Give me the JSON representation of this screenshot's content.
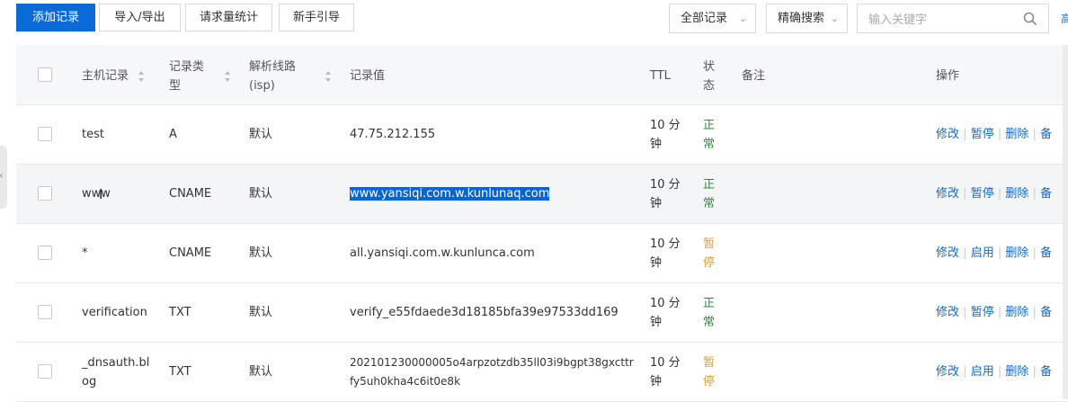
{
  "toolbar": {
    "add_label": "添加记录",
    "import_label": "导入/导出",
    "stats_label": "请求量统计",
    "guide_label": "新手引导",
    "filter_all": "全部记录",
    "filter_exact": "精确搜索",
    "search_placeholder": "输入关键字",
    "right_cut_label": "高"
  },
  "header": {
    "host": "主机记录",
    "type": "记录类型",
    "line": "解析线路(isp)",
    "value": "记录值",
    "ttl": "TTL",
    "status": "状态",
    "remark": "备注",
    "ops": "操作"
  },
  "rows": [
    {
      "host": "test",
      "type": "A",
      "line": "默认",
      "value": "47.75.212.155",
      "ttl": "10 分钟",
      "status": "正常",
      "ops": [
        "修改",
        "暂停",
        "删除",
        "备"
      ]
    },
    {
      "host": "www",
      "type": "CNAME",
      "line": "默认",
      "value": "www.yansiqi.com.w.kunlunaq.com",
      "ttl": "10 分钟",
      "status": "正常",
      "ops": [
        "修改",
        "暂停",
        "删除",
        "备"
      ]
    },
    {
      "host": "*",
      "type": "CNAME",
      "line": "默认",
      "value": "all.yansiqi.com.w.kunlunca.com",
      "ttl": "10 分钟",
      "status": "暂停",
      "ops": [
        "修改",
        "启用",
        "删除",
        "备"
      ]
    },
    {
      "host": "verification",
      "type": "TXT",
      "line": "默认",
      "value": "verify_e55fdaede3d18185bfa39e97533dd169",
      "ttl": "10 分钟",
      "status": "正常",
      "ops": [
        "修改",
        "暂停",
        "删除",
        "备"
      ]
    },
    {
      "host": "_dnsauth.blog",
      "type": "TXT",
      "line": "默认",
      "value": "202101230000005o4arpzotzdb35ll03i9bgpt38gxcttrfy5uh0kha4c6it0e8k",
      "ttl": "10 分钟",
      "status": "暂停",
      "ops": [
        "修改",
        "启用",
        "删除",
        "备"
      ]
    }
  ],
  "colors": {
    "accent": "#0a6bd6",
    "ok": "#2a8a3a",
    "paused": "#e6a020",
    "selection": "#0a64d6"
  },
  "icons": {
    "search": "search-icon",
    "sort": "sort-icon",
    "chevron": "chevron-down-icon",
    "cursor": "text-cursor-icon",
    "collapse": "chevron-left-icon"
  }
}
